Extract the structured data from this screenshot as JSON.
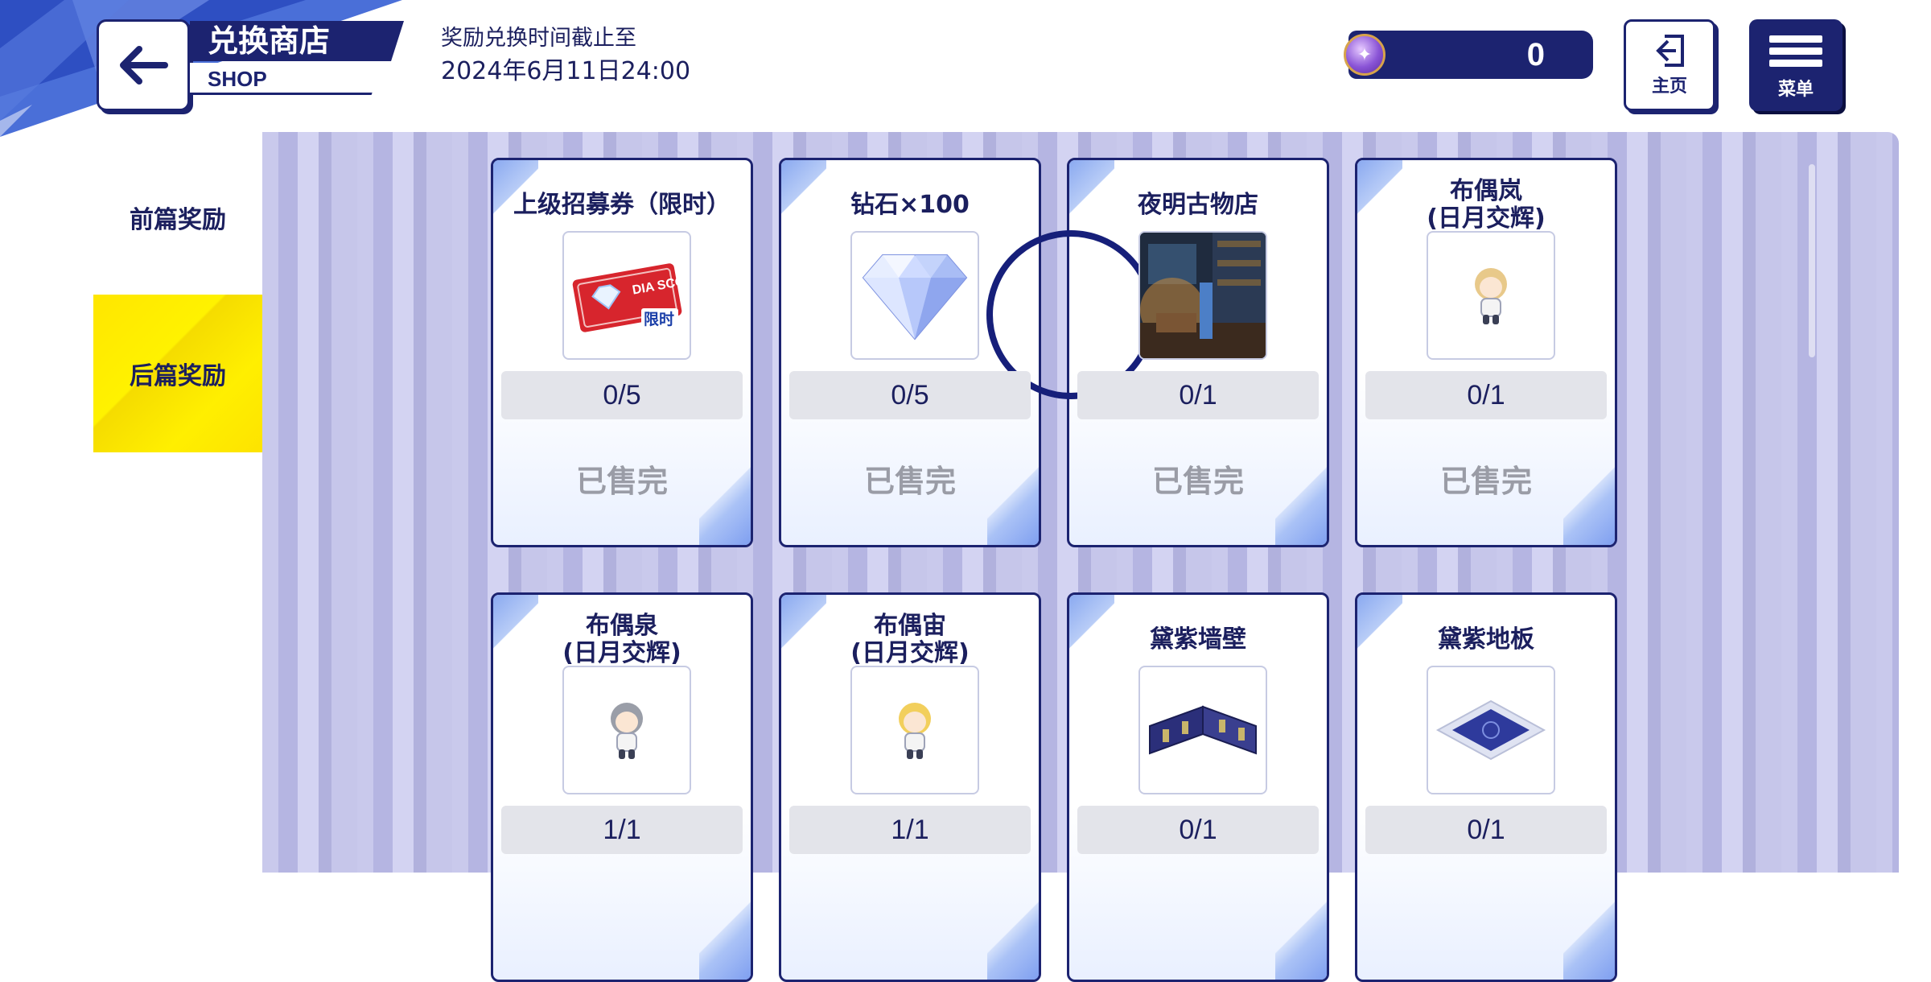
{
  "header": {
    "title": "兑换商店",
    "subtitle": "SHOP",
    "deadline_label": "奖励兑换时间截止至",
    "deadline_value": "2024年6月11日24:00"
  },
  "currency": {
    "value": "0",
    "icon": "purple-medal-icon"
  },
  "nav": {
    "home_label": "主页",
    "menu_label": "菜单"
  },
  "tabs": [
    {
      "label": "前篇奖励",
      "active": false
    },
    {
      "label": "后篇奖励",
      "active": true
    }
  ],
  "items": [
    {
      "name": "上级招募券（限时）",
      "count": "0/5",
      "status": "已售完",
      "icon": "scout-ticket-icon",
      "ticket_text": "DIA SCOUT",
      "ticket_badge": "限时"
    },
    {
      "name": "钻石×100",
      "count": "0/5",
      "status": "已售完",
      "icon": "diamond-icon"
    },
    {
      "name": "夜明古物店",
      "count": "0/1",
      "status": "已售完",
      "icon": "shop-background-icon"
    },
    {
      "name": "布偶岚\n(日月交辉)",
      "count": "0/1",
      "status": "已售完",
      "icon": "plush-blonde-icon"
    },
    {
      "name": "布偶泉\n(日月交辉)",
      "count": "1/1",
      "icon": "plush-grey-hair-icon"
    },
    {
      "name": "布偶宙\n(日月交辉)",
      "count": "1/1",
      "icon": "plush-yellow-hair-icon"
    },
    {
      "name": "黛紫墙壁",
      "count": "0/1",
      "icon": "wall-icon"
    },
    {
      "name": "黛紫地板",
      "count": "0/1",
      "icon": "floor-icon"
    }
  ],
  "colors": {
    "navy": "#1c2370",
    "active_tab": "#fff200",
    "panel_stripe": "#c9c9ec",
    "sold_text": "#9a9ca6"
  }
}
